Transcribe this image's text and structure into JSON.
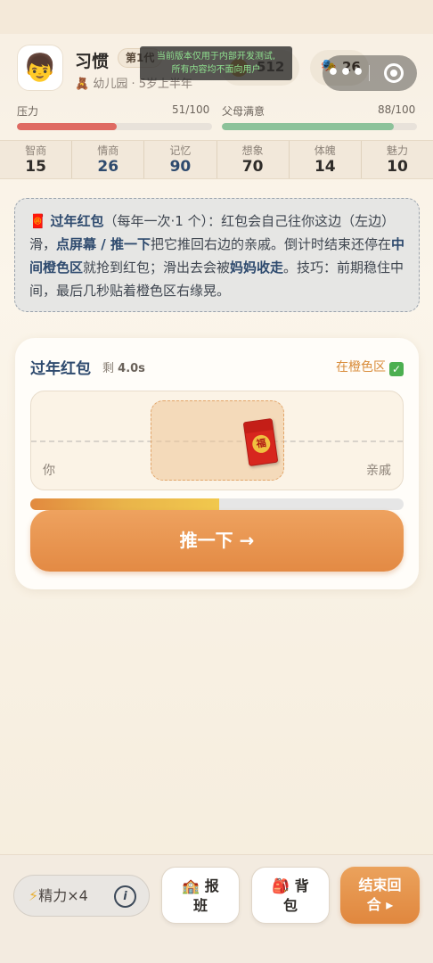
{
  "header": {
    "avatar_emoji": "👦",
    "name": "习惯",
    "generation": "第1代",
    "stage": "🧸 幼儿园 · 5岁上半年",
    "coins": "512",
    "energy": "26",
    "capsule_more": "•••"
  },
  "watermark": {
    "line1": "当前版本仅用于内部开发测试,",
    "line2": "所有内容均不面向用户"
  },
  "bars": {
    "pressure": {
      "label": "压力",
      "value": "51/100",
      "fraction": 0.51,
      "color": "#df6a62"
    },
    "parent": {
      "label": "父母满意",
      "value": "88/100",
      "fraction": 0.88,
      "color": "#8cc29a"
    }
  },
  "stats": [
    {
      "label": "智商",
      "value": "15"
    },
    {
      "label": "情商",
      "value": "26"
    },
    {
      "label": "记忆",
      "value": "90"
    },
    {
      "label": "想象",
      "value": "70"
    },
    {
      "label": "体魄",
      "value": "14"
    },
    {
      "label": "魅力",
      "value": "10"
    }
  ],
  "hint": {
    "icon": "🧧",
    "title": "过年红包",
    "p1": "（每年一次·1 个）：红包会自己往你这边（左边）滑，",
    "b1": "点屏幕 / 推一下",
    "p2": "把它推回右边的亲戚。倒计时结束还停在",
    "b2": "中间橙色区",
    "p3": "就抢到红包；滑出去会被",
    "b3": "妈妈收走",
    "p4": "。技巧：前期稳住中间，最后几秒贴着橙色区右缘晃。"
  },
  "game": {
    "title": "过年红包",
    "remain_label": "剩",
    "remain_value": "4.0s",
    "status": "在橙色区",
    "status_check": "✓",
    "left_label": "你",
    "right_label": "亲戚",
    "envelope_char": "福",
    "timer_fraction": 0.505,
    "push_label": "推一下 →"
  },
  "bottom": {
    "energy_bolt": "⚡",
    "energy_label": "精力×4",
    "info": "i",
    "school_icon": "🏫",
    "school_a": "报",
    "school_b": "班",
    "bag_icon": "🎒",
    "bag_a": "背",
    "bag_b": "包",
    "end_a": "结束回",
    "end_b": "合 ▸"
  }
}
